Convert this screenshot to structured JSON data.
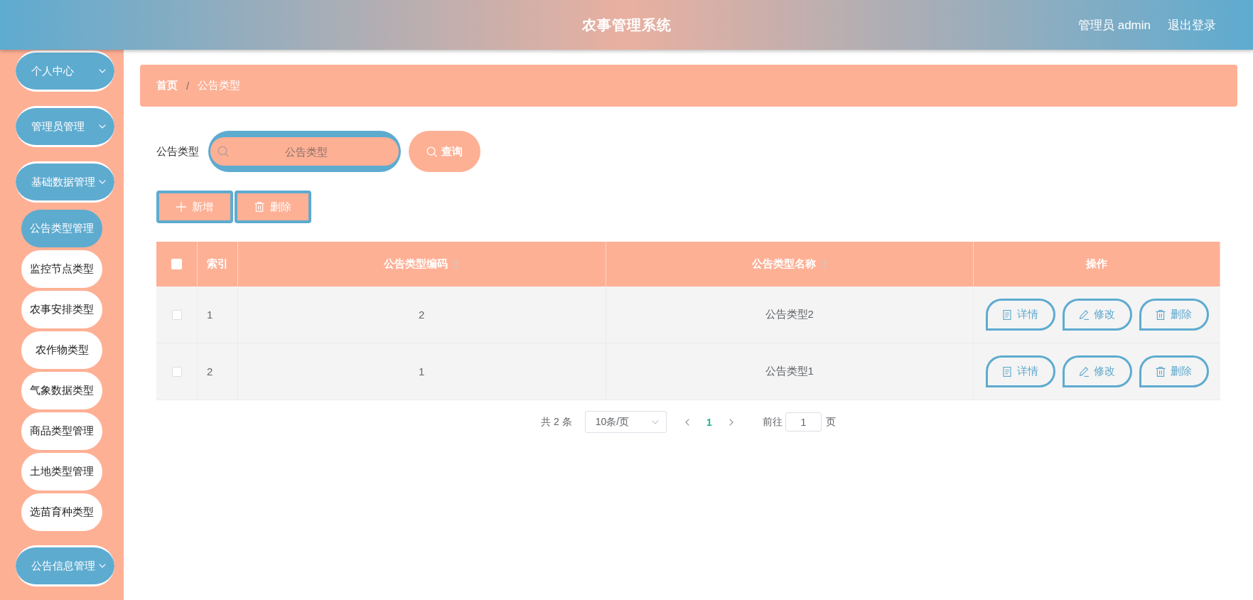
{
  "header": {
    "title": "农事管理系统",
    "user": "管理员 admin",
    "logout": "退出登录"
  },
  "sidebar": {
    "items": [
      {
        "label": "个人中心"
      },
      {
        "label": "管理员管理"
      },
      {
        "label": "基础数据管理",
        "children": [
          {
            "label": "公告类型管理",
            "selected": true
          },
          {
            "label": "监控节点类型",
            "selected": false
          },
          {
            "label": "农事安排类型",
            "selected": false
          },
          {
            "label": "农作物类型",
            "selected": false
          },
          {
            "label": "气象数据类型",
            "selected": false
          },
          {
            "label": "商品类型管理",
            "selected": false
          },
          {
            "label": "土地类型管理",
            "selected": false
          },
          {
            "label": "选苗育种类型",
            "selected": false
          }
        ]
      },
      {
        "label": "公告信息管理"
      }
    ]
  },
  "breadcrumb": {
    "items": [
      "首页",
      "公告类型"
    ],
    "separator": "/"
  },
  "search": {
    "label": "公告类型",
    "placeholder": "公告类型",
    "button": "查询"
  },
  "toolbar": [
    {
      "kind": "add",
      "label": "新增"
    },
    {
      "kind": "delete",
      "label": "删除"
    }
  ],
  "table": {
    "select_all": {
      "checked": false
    },
    "columns": [
      {
        "label": "索引",
        "sortable": false
      },
      {
        "label": "公告类型编码",
        "sortable": true
      },
      {
        "label": "公告类型名称",
        "sortable": true
      },
      {
        "label": "操作",
        "sortable": false
      }
    ],
    "rows": [
      {
        "checked": false,
        "cells": [
          "1",
          "2",
          "公告类型2"
        ],
        "actions": [
          {
            "kind": "detail",
            "label": "详情"
          },
          {
            "kind": "edit",
            "label": "修改"
          },
          {
            "kind": "delete",
            "label": "删除"
          }
        ]
      },
      {
        "checked": false,
        "cells": [
          "2",
          "1",
          "公告类型1"
        ],
        "actions": [
          {
            "kind": "detail",
            "label": "详情"
          },
          {
            "kind": "edit",
            "label": "修改"
          },
          {
            "kind": "delete",
            "label": "删除"
          }
        ]
      }
    ]
  },
  "pagination": {
    "total": "共 2 条",
    "page_size": "10条/页",
    "pages": [
      {
        "label": "1",
        "selected": true
      }
    ],
    "goto_label": "前往",
    "goto_value": "1",
    "goto_suffix": "页"
  }
}
